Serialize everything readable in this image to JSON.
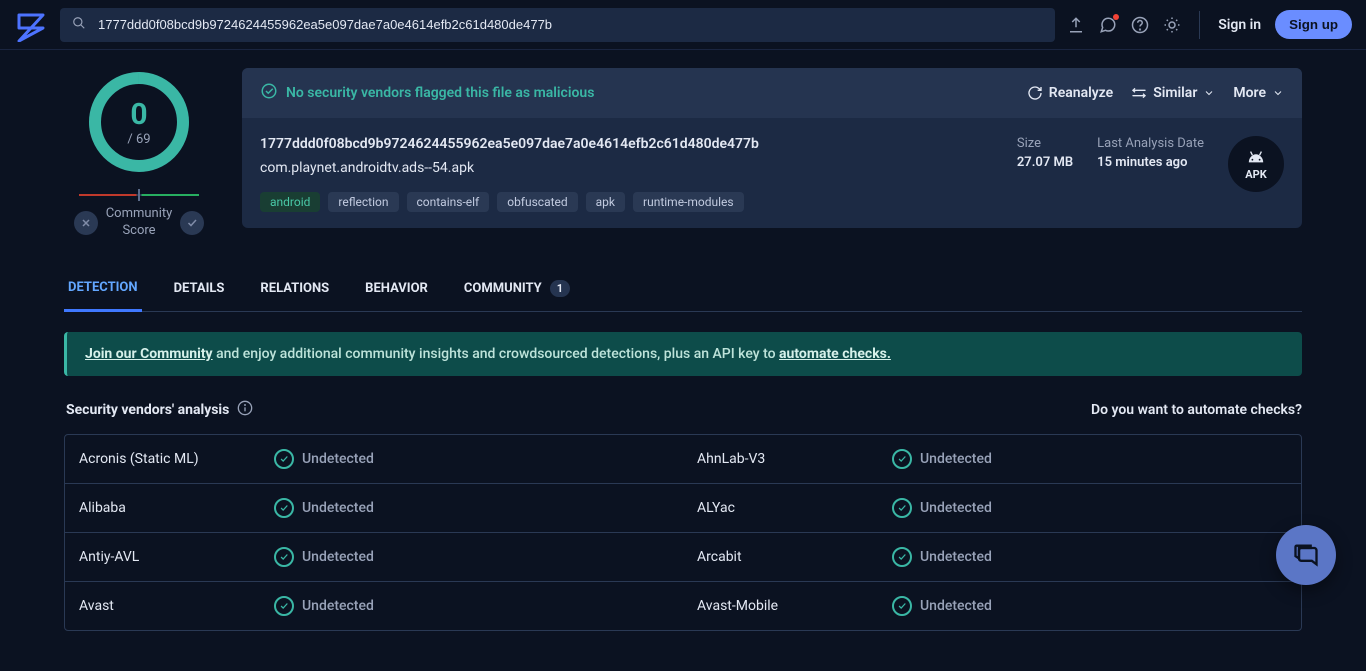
{
  "nav": {
    "search_value": "1777ddd0f08bcd9b9724624455962ea5e097dae7a0e4614efb2c61d480de477b",
    "signin": "Sign in",
    "signup": "Sign up"
  },
  "score": {
    "value": "0",
    "total": "/ 69",
    "community_label": "Community\nScore"
  },
  "summary": {
    "flag_msg": "No security vendors flagged this file as malicious",
    "reanalyze": "Reanalyze",
    "similar": "Similar",
    "more": "More",
    "hash": "1777ddd0f08bcd9b9724624455962ea5e097dae7a0e4614efb2c61d480de477b",
    "filename": "com.playnet.androidtv.ads--54.apk",
    "tags": [
      "android",
      "reflection",
      "contains-elf",
      "obfuscated",
      "apk",
      "runtime-modules"
    ],
    "meta": {
      "size_label": "Size",
      "size_val": "27.07 MB",
      "lad_label": "Last Analysis Date",
      "lad_val": "15 minutes ago"
    },
    "apk_label": "APK"
  },
  "tabs": {
    "items": [
      {
        "label": "DETECTION",
        "active": true
      },
      {
        "label": "DETAILS"
      },
      {
        "label": "RELATIONS"
      },
      {
        "label": "BEHAVIOR"
      },
      {
        "label": "COMMUNITY",
        "badge": "1"
      }
    ]
  },
  "banner": {
    "join": "Join our Community",
    "mid": " and enjoy additional community insights and crowdsourced detections, plus an API key to ",
    "auto": "automate checks."
  },
  "section": {
    "title": "Security vendors' analysis",
    "right": "Do you want to automate checks?"
  },
  "vendors": [
    {
      "name": "Acronis (Static ML)",
      "status": "Undetected",
      "name2": "AhnLab-V3",
      "status2": "Undetected"
    },
    {
      "name": "Alibaba",
      "status": "Undetected",
      "name2": "ALYac",
      "status2": "Undetected"
    },
    {
      "name": "Antiy-AVL",
      "status": "Undetected",
      "name2": "Arcabit",
      "status2": "Undetected"
    },
    {
      "name": "Avast",
      "status": "Undetected",
      "name2": "Avast-Mobile",
      "status2": "Undetected"
    }
  ]
}
